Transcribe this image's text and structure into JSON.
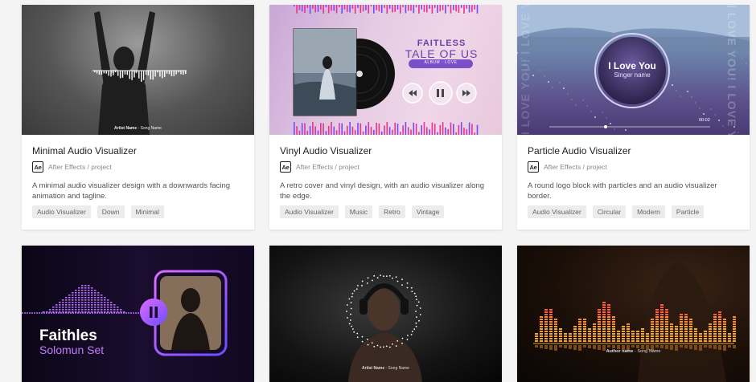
{
  "cards": [
    {
      "title": "Minimal Audio Visualizer",
      "app_badge": "Ae",
      "meta": "After Effects / project",
      "description": "A minimal audio visualizer design with a downwards facing animation and tagline.",
      "tags": [
        "Audio Visualizer",
        "Down",
        "Minimal"
      ],
      "thumb": {
        "caption_bold": "Artist Name",
        "caption": " - Song Name"
      }
    },
    {
      "title": "Vinyl Audio Visualizer",
      "app_badge": "Ae",
      "meta": "After Effects / project",
      "description": "A retro cover and vinyl design, with an audio visualizer along the edge.",
      "tags": [
        "Audio Visualizer",
        "Music",
        "Retro",
        "Vintage"
      ],
      "thumb": {
        "line1": "FAITLESS",
        "line2": "TALE OF US",
        "pill": "ALBUM · LOVE"
      }
    },
    {
      "title": "Particle Audio Visualizer",
      "app_badge": "Ae",
      "meta": "After Effects / project",
      "description": "A round logo block with particles and an audio visualizer border.",
      "tags": [
        "Audio Visualizer",
        "Circular",
        "Modern",
        "Particle"
      ],
      "thumb": {
        "heading": "I Love You",
        "sub": "Singer name",
        "time": "00:02",
        "side_text": "I LOVE YOU! I LOVE YOU!"
      }
    }
  ],
  "thumbs_bottom": [
    {
      "line1": "Faithles",
      "line2": "Solomun Set"
    },
    {
      "caption_bold": "Artist Name",
      "caption": " - Song Name"
    },
    {
      "caption_bold": "Author name",
      "caption": " - Song Name"
    }
  ],
  "colors": {
    "purple_accent": "#b66bff",
    "pink_bars": "#e6338f",
    "orange_bars": "#f5a623"
  },
  "icons": [
    "after-effects-icon",
    "play-pause-icon",
    "rewind-icon",
    "forward-icon"
  ]
}
